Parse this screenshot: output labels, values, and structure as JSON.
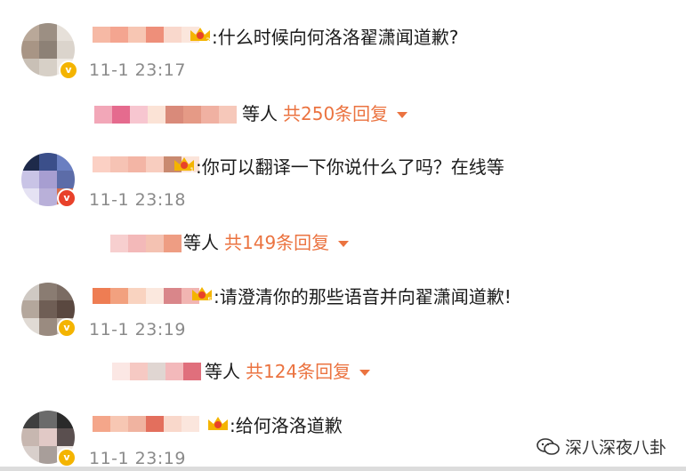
{
  "comments": [
    {
      "text": ":什么时候向何洛洛翟潇闻道歉?",
      "time": "11-1 23:17",
      "reply_suffix": "等人",
      "reply_count": "共250条回复",
      "badge_level": "3",
      "avatar_colors": [
        "#b9a899",
        "#9c8f83",
        "#e6e0d9",
        "#a89585",
        "#8d8176",
        "#dbd4cc",
        "#c9c0b6",
        "#d7d0c7",
        "#efeae5"
      ],
      "name_colors": [
        "#f6b9a5",
        "#f4a590",
        "#f7c6b3",
        "#ee8f7a",
        "#f9d8cc",
        "#fbe6dc"
      ],
      "reply_colors": [
        "#f2a7b8",
        "#e56b8e",
        "#f7c6d0",
        "#fbe3d6",
        "#d98a7a",
        "#e59a86",
        "#f0b1a2",
        "#f6c8ba"
      ]
    },
    {
      "text": ":你可以翻译一下你说什么了吗？在线等",
      "time": "11-1 23:18",
      "reply_suffix": "等人",
      "reply_count": "共149条回复",
      "badge_level": "1",
      "avatar_colors": [
        "#1e2a4a",
        "#3b4f8a",
        "#6a7fc1",
        "#c9c4e6",
        "#a79ed1",
        "#5c6ca8",
        "#e5e2f3",
        "#b9b0d9",
        "#d86b48"
      ],
      "name_colors": [
        "#fbd0c4",
        "#f6c3b4",
        "#f3b5a5",
        "#f8cdbf",
        "#c98a70",
        "#fbe4da"
      ],
      "reply_colors": [
        "#f7cfcf",
        "#f3b9b9",
        "#f4c2b2",
        "#ee9d83"
      ]
    },
    {
      "text": ":请澄清你的那些语音并向翟潇闻道歉!",
      "time": "11-1 23:19",
      "reply_suffix": "等人",
      "reply_count": "共124条回复",
      "badge_level": "5",
      "avatar_colors": [
        "#cfc9c3",
        "#8a7c72",
        "#7b6c63",
        "#b4a79c",
        "#6f5e55",
        "#5a4840",
        "#e0dad4",
        "#9a8b80",
        "#c4b8ae"
      ],
      "name_colors": [
        "#ee7d53",
        "#f2a17f",
        "#f9d3c0",
        "#fbe8de",
        "#d9868a",
        "#f1b5b2"
      ],
      "reply_colors": [
        "#fbe7e4",
        "#f6c9c3",
        "#e0d6d2",
        "#f3b9bb",
        "#e06f7c"
      ]
    },
    {
      "text": ":给何洛洛道歉",
      "time": "11-1 23:19",
      "badge_level": "",
      "avatar_colors": [
        "#3f3f3f",
        "#6b6b6b",
        "#2a2a2a",
        "#c7b7b0",
        "#e1c9c6",
        "#5a4f4f",
        "#d8cfcb",
        "#a89e9a",
        "#efe8e5"
      ],
      "name_colors": [
        "#f4a68a",
        "#f7c7b3",
        "#f0b3a0",
        "#e36f5d",
        "#f9d8cb",
        "#fbe6dd"
      ]
    }
  ],
  "watermark": {
    "text": "深八深夜八卦",
    "icon": "wechat-icon"
  },
  "colors": {
    "accent": "#eb7340",
    "time": "#8a8a8a",
    "badge_gold": "#f4b400"
  }
}
